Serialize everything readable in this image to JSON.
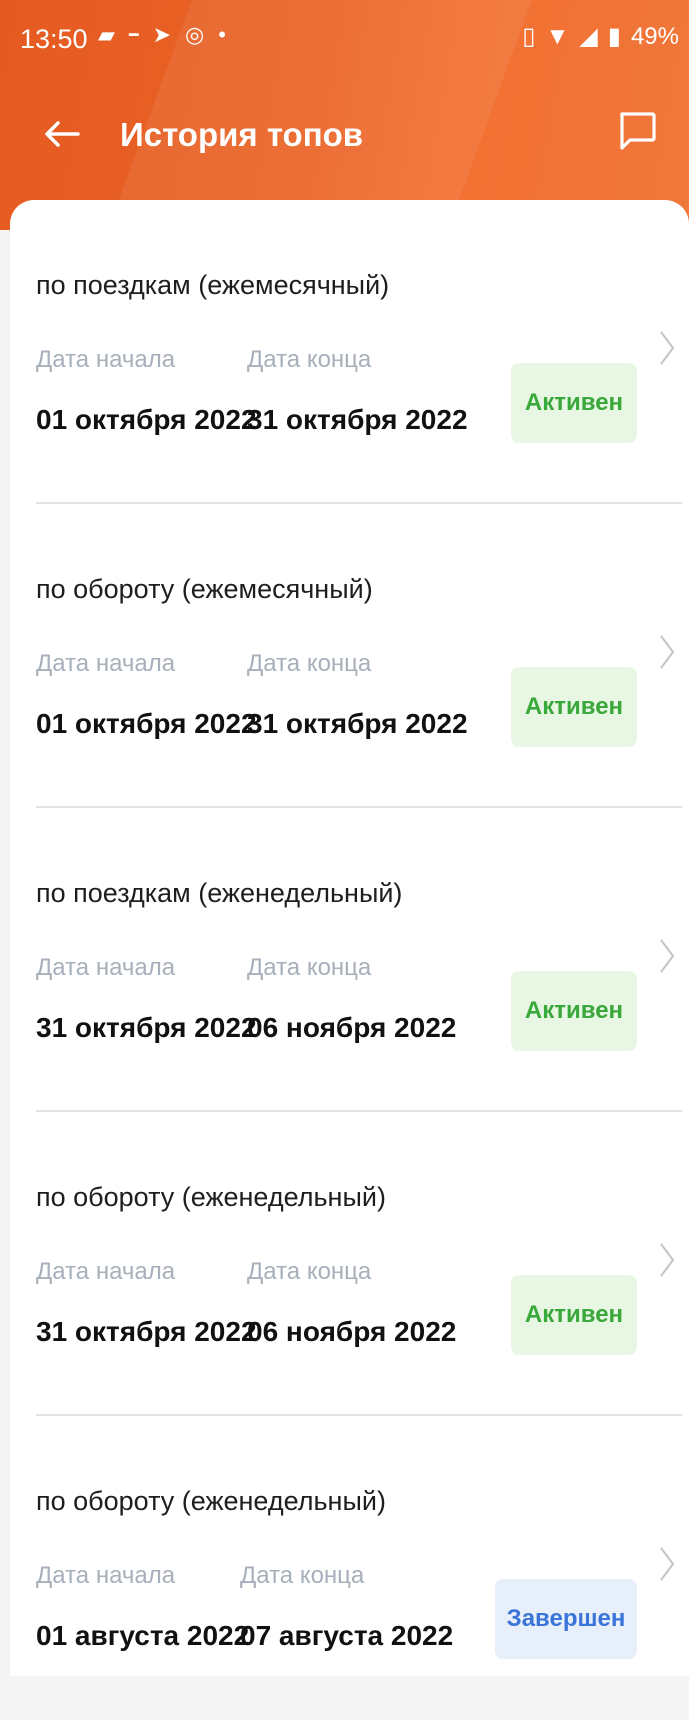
{
  "status": {
    "time": "13:50",
    "battery": "49%"
  },
  "header": {
    "title": "История топов"
  },
  "labels": {
    "start": "Дата начала",
    "end": "Дата конца"
  },
  "items": [
    {
      "title": "по поездкам (ежемесячный)",
      "start": "01 октября 2022",
      "end": "31 октября 2022",
      "status": "Активен"
    },
    {
      "title": "по обороту (ежемесячный)",
      "start": "01 октября 2022",
      "end": "31 октября 2022",
      "status": "Активен"
    },
    {
      "title": "по поездкам (еженедельный)",
      "start": "31 октября 2022",
      "end": "06 ноября 2022",
      "status": "Активен"
    },
    {
      "title": "по обороту (еженедельный)",
      "start": "31 октября 2022",
      "end": "06 ноября 2022",
      "status": "Активен"
    },
    {
      "title": "по обороту (еженедельный)",
      "start": "01 августа 2022",
      "end": "07 августа 2022",
      "status": "Завершен"
    }
  ],
  "colors": {
    "header": "#ea6426",
    "active_text": "#3aa83b",
    "active_bg": "#e8f6e4",
    "done_text": "#3b74d8",
    "done_bg": "#e7effb"
  }
}
